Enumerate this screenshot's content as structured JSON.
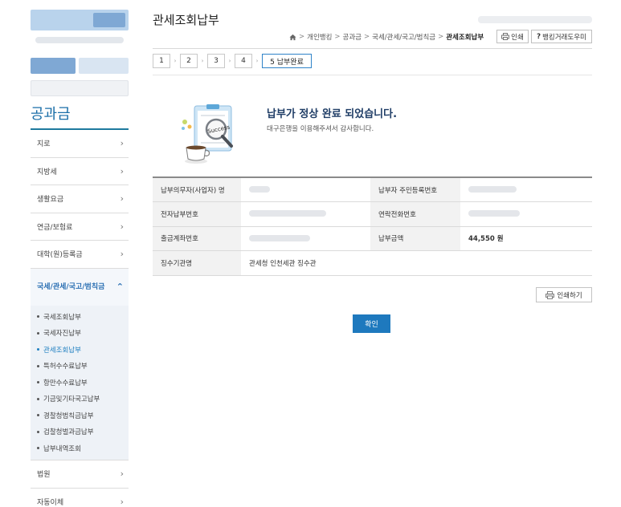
{
  "page": {
    "title": "관세조회납부"
  },
  "breadcrumb": {
    "items": [
      "개인뱅킹",
      "공과금",
      "국세/관세/국고/범칙금"
    ],
    "current": "관세조회납부",
    "print_label": "인쇄",
    "help_label": "뱅킹거래도우미"
  },
  "steps": [
    {
      "label": "1"
    },
    {
      "label": "2"
    },
    {
      "label": "3"
    },
    {
      "label": "4"
    },
    {
      "label": "5 납부완료"
    }
  ],
  "sidebar": {
    "title": "공과금",
    "items": [
      {
        "label": "지로"
      },
      {
        "label": "지방세"
      },
      {
        "label": "생활요금"
      },
      {
        "label": "연금/보험료"
      },
      {
        "label": "대학(원)등록금"
      }
    ],
    "active": {
      "label": "국세/관세/국고/범칙금"
    },
    "sub_items": [
      {
        "label": "국세조회납부"
      },
      {
        "label": "국세자진납부"
      },
      {
        "label": "관세조회납부"
      },
      {
        "label": "특허수수료납부"
      },
      {
        "label": "항만수수료납부"
      },
      {
        "label": "기금및기타국고납부"
      },
      {
        "label": "경찰청범칙금납부"
      },
      {
        "label": "검찰청벌과금납부"
      },
      {
        "label": "납부내역조회"
      }
    ],
    "after_items": [
      {
        "label": "법원"
      },
      {
        "label": "자동이체"
      }
    ]
  },
  "result": {
    "title": "납부가 정상 완료 되었습니다.",
    "subtitle": "대구은행을 이용해주셔서 감사합니다.",
    "illustration_text": "Success"
  },
  "table": {
    "rows": [
      {
        "label1": "납부의무자(사업자) 명",
        "value1": "",
        "label2": "납부자 주민등록번호",
        "value2": ""
      },
      {
        "label1": "전자납부번호",
        "value1": "",
        "label2": "연락전화번호",
        "value2": ""
      },
      {
        "label1": "출금계좌번호",
        "value1": "",
        "label2": "납부금액",
        "value2": "44,550 원"
      },
      {
        "label1": "징수기관명",
        "value1": "관세청 인천세관 징수관"
      }
    ]
  },
  "buttons": {
    "print": "인쇄하기",
    "confirm": "확인"
  },
  "colors": {
    "accent": "#1e79be",
    "title_blue": "#1a6ea8",
    "active_menu": "#2a6fb3"
  },
  "icons": {
    "home": "home-icon",
    "print": "printer-icon",
    "help": "question-icon",
    "chevron": "chevron-right-icon"
  }
}
